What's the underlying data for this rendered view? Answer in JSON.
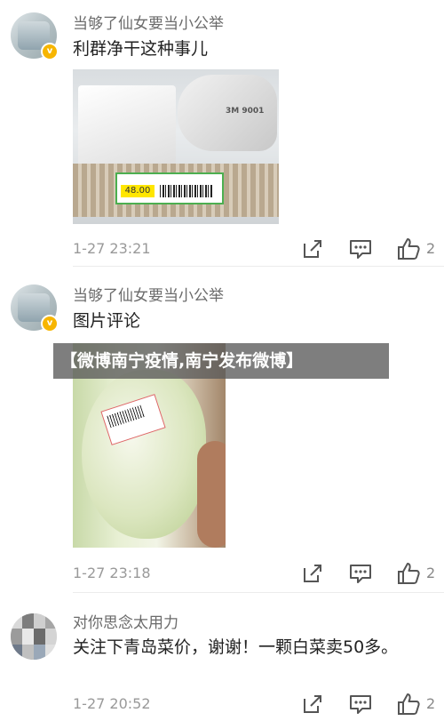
{
  "comments": [
    {
      "username": "当够了仙女要当小公举",
      "text": "利群净干这种事儿",
      "time": "1-27 23:21",
      "likes": "2",
      "photo_texts": {
        "mask_model": "3M 9001",
        "price_tag": "48.00"
      }
    },
    {
      "username": "当够了仙女要当小公举",
      "text": "图片评论",
      "time": "1-27 23:18",
      "likes": "2"
    },
    {
      "username": "对你思念太用力",
      "text": "关注下青岛菜价，谢谢！一颗白菜卖50多。",
      "time": "1-27 20:52",
      "likes": "2"
    }
  ],
  "banner": "【微博南宁疫情,南宁发布微博】",
  "icons": {
    "verified": "verified-badge-icon",
    "share": "share-icon",
    "comment": "comment-icon",
    "like": "thumbs-up-icon"
  },
  "colors": {
    "verified_badge": "#f7b500",
    "username": "#6b6b6b",
    "time": "#999999"
  }
}
